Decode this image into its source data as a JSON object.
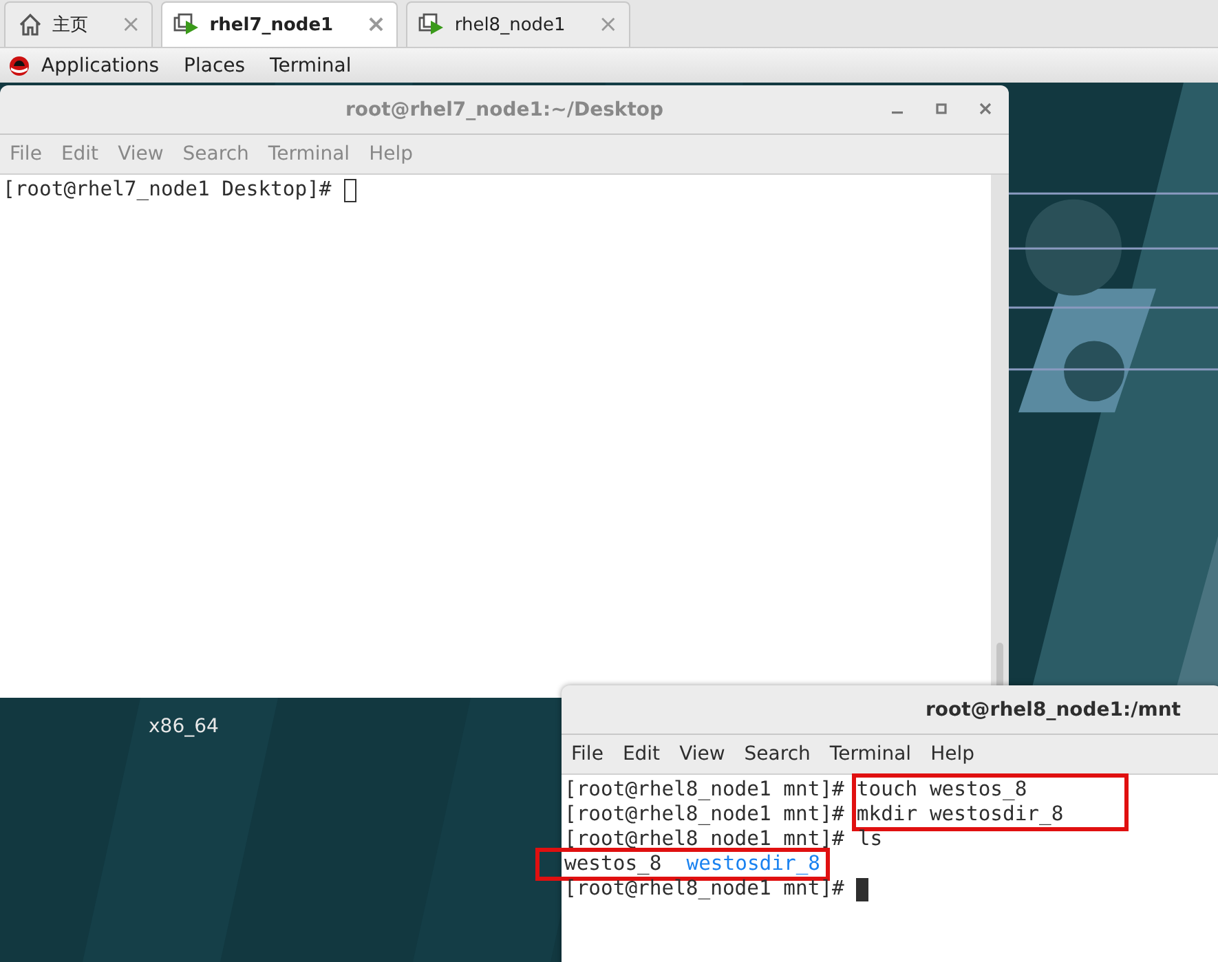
{
  "tabs": [
    {
      "label": "主页",
      "kind": "home",
      "selected": false,
      "close": "×"
    },
    {
      "label": "rhel7_node1",
      "kind": "vm",
      "selected": true,
      "close": "×"
    },
    {
      "label": "rhel8_node1",
      "kind": "vm",
      "selected": false,
      "close": "×"
    }
  ],
  "top_bar": {
    "items": [
      "Applications",
      "Places",
      "Terminal"
    ]
  },
  "desktop": {
    "label": "x86_64"
  },
  "windows": [
    {
      "title": "root@rhel7_node1:~/Desktop",
      "focused": false,
      "controls": true,
      "menu": [
        "File",
        "Edit",
        "View",
        "Search",
        "Terminal",
        "Help"
      ],
      "lines": [
        {
          "kind": "prompt",
          "prompt": "[root@rhel7_node1 Desktop]#",
          "boxed": false
        }
      ]
    },
    {
      "title": "root@rhel8_node1:/mnt",
      "focused": true,
      "controls": false,
      "menu": [
        "File",
        "Edit",
        "View",
        "Search",
        "Terminal",
        "Help"
      ],
      "lines": [
        {
          "kind": "command",
          "prompt": "[root@rhel8_node1 mnt]#",
          "command": "touch westos_8",
          "boxed": true
        },
        {
          "kind": "command",
          "prompt": "[root@rhel8_node1 mnt]#",
          "command": "mkdir westosdir_8",
          "boxed": true
        },
        {
          "kind": "command",
          "prompt": "[root@rhel8_node1 mnt]#",
          "command": "ls",
          "boxed": false
        },
        {
          "kind": "output",
          "items": [
            {
              "text": "westos_8",
              "kind": "file"
            },
            {
              "text": "westosdir_8",
              "kind": "dir"
            }
          ],
          "boxed": true
        },
        {
          "kind": "prompt",
          "prompt": "[root@rhel8_node1 mnt]#",
          "boxed": false
        }
      ]
    }
  ]
}
